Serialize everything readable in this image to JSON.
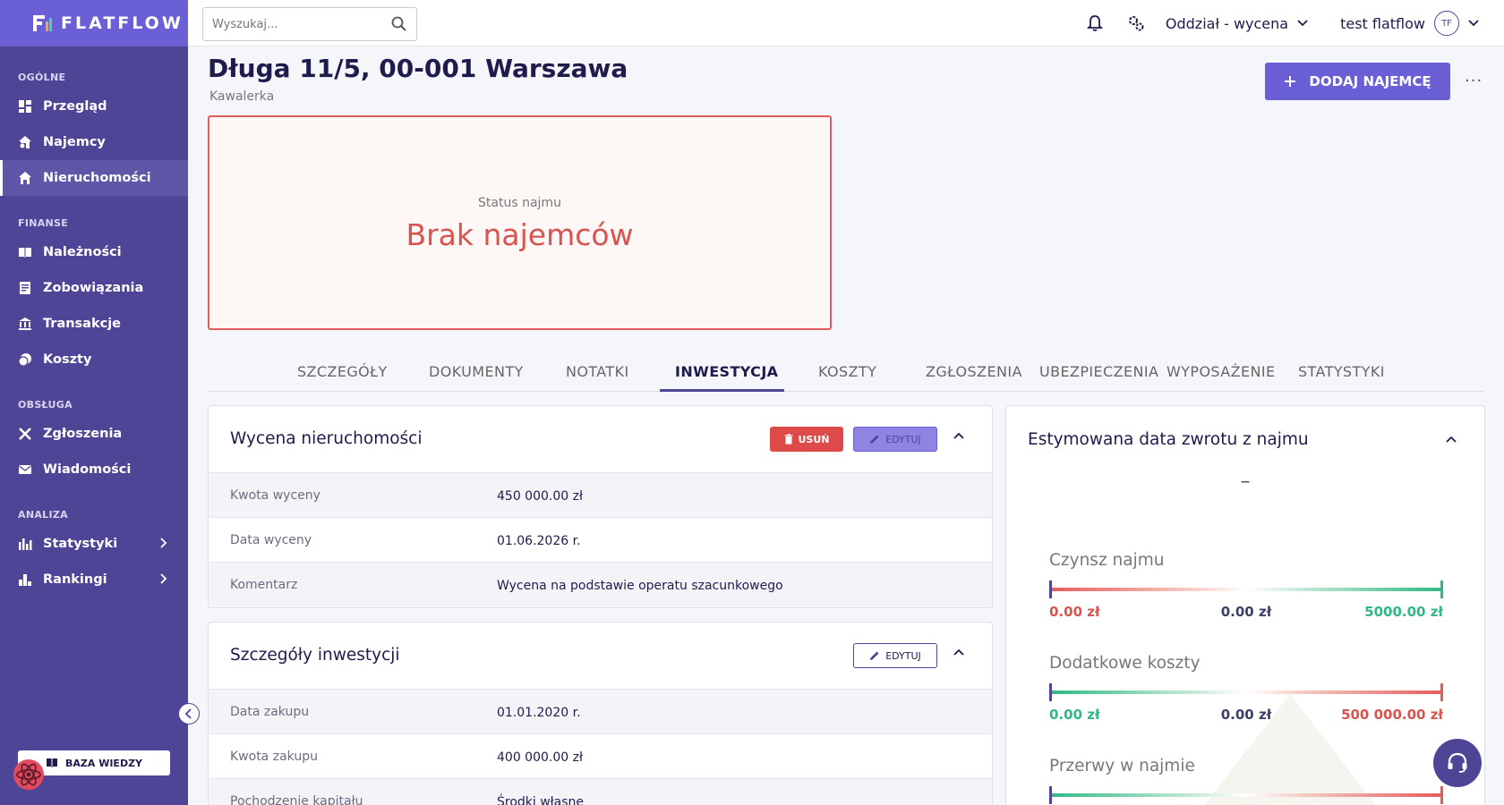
{
  "brand": {
    "name": "FLATFLOW"
  },
  "sidebar": {
    "sections": [
      {
        "title": "OGÓLNE",
        "items": [
          {
            "label": "Przegląd"
          },
          {
            "label": "Najemcy"
          },
          {
            "label": "Nieruchomości"
          }
        ]
      },
      {
        "title": "FINANSE",
        "items": [
          {
            "label": "Należności"
          },
          {
            "label": "Zobowiązania"
          },
          {
            "label": "Transakcje"
          },
          {
            "label": "Koszty"
          }
        ]
      },
      {
        "title": "OBSŁUGA",
        "items": [
          {
            "label": "Zgłoszenia"
          },
          {
            "label": "Wiadomości"
          }
        ]
      },
      {
        "title": "ANALIZA",
        "items": [
          {
            "label": "Statystyki"
          },
          {
            "label": "Rankingi"
          }
        ]
      }
    ],
    "active_item": "Nieruchomości",
    "knowledge_base_label": "BAZA WIEDZY"
  },
  "topbar": {
    "search_placeholder": "Wyszukaj...",
    "branch": "Oddział - wycena",
    "user_name": "test flatflow",
    "user_initials": "TF"
  },
  "header": {
    "title": "Długa 11/5, 00-001 Warszawa",
    "subtitle": "Kawalerka",
    "add_tenant_label": "DODAJ NAJEMCĘ",
    "more_label": "···"
  },
  "status": {
    "label": "Status najmu",
    "value": "Brak najemców"
  },
  "tabs": [
    {
      "label": "SZCZEGÓŁY"
    },
    {
      "label": "DOKUMENTY"
    },
    {
      "label": "NOTATKI"
    },
    {
      "label": "INWESTYCJA"
    },
    {
      "label": "KOSZTY"
    },
    {
      "label": "ZGŁOSZENIA"
    },
    {
      "label": "UBEZPIECZENIA"
    },
    {
      "label": "WYPOSAŻENIE"
    },
    {
      "label": "STATYSTYKI"
    }
  ],
  "active_tab": "INWESTYCJA",
  "valuation": {
    "title": "Wycena nieruchomości",
    "delete_label": "USUŃ",
    "edit_label": "EDYTUJ",
    "rows": [
      {
        "key": "Kwota wyceny",
        "value": "450 000.00 zł"
      },
      {
        "key": "Data wyceny",
        "value": "01.06.2026 r."
      },
      {
        "key": "Komentarz",
        "value": "Wycena na podstawie operatu szacunkowego"
      }
    ]
  },
  "investment": {
    "title": "Szczegóły inwestycji",
    "edit_label": "EDYTUJ",
    "rows": [
      {
        "key": "Data zakupu",
        "value": "01.01.2020 r."
      },
      {
        "key": "Kwota zakupu",
        "value": "400 000.00 zł"
      },
      {
        "key": "Pochodzenie kapitału",
        "value": "Środki własne"
      }
    ]
  },
  "estimate": {
    "title": "Estymowana data zwrotu z najmu",
    "value": "–",
    "metrics": [
      {
        "title": "Czynsz najmu",
        "min": "0.00 zł",
        "current": "0.00 zł",
        "max": "5000.00 zł"
      },
      {
        "title": "Dodatkowe koszty",
        "min": "0.00 zł",
        "current": "0.00 zł",
        "max": "500 000.00 zł"
      },
      {
        "title": "Przerwy w najmie"
      }
    ]
  },
  "colors": {
    "primary": "#6b5fd6",
    "sidebar": "#4e4597",
    "danger": "#d9534f",
    "success": "#2fb884"
  }
}
